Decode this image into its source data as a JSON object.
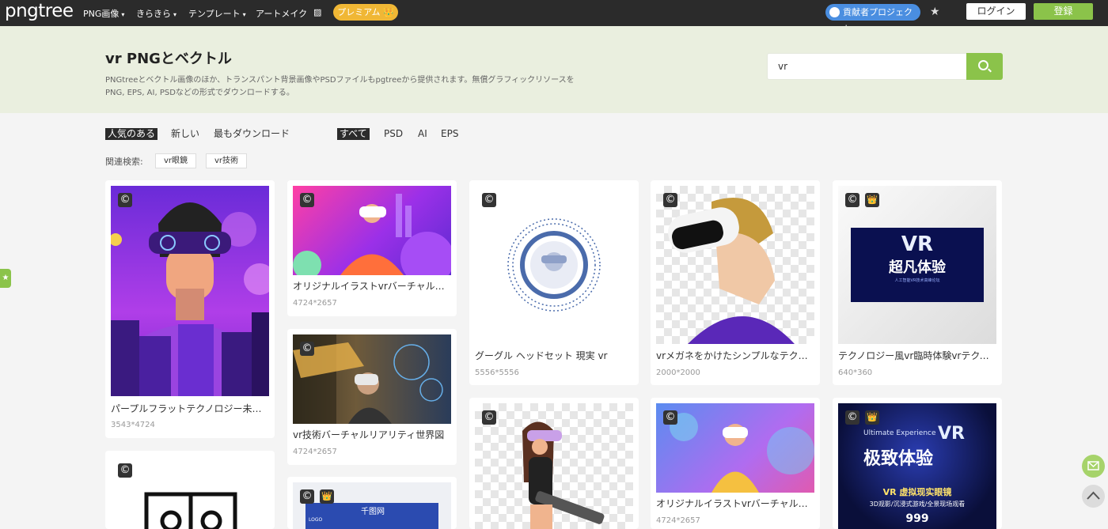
{
  "header": {
    "logo": "pngtree",
    "nav": [
      {
        "label": "PNG画像",
        "caret": "▾"
      },
      {
        "label": "きらきら",
        "caret": "▾"
      },
      {
        "label": "テンプレート",
        "caret": "▾"
      },
      {
        "label": "アートメイク",
        "caret": ""
      },
      {
        "label": "▨",
        "caret": ""
      }
    ],
    "premium": "プレミアム 👑",
    "contributor": "貢献者プロジェクト",
    "star": "★",
    "login": "ログイン",
    "register": "登録"
  },
  "hero": {
    "title": "vr PNGとベクトル",
    "description": "PNGtreeとベクトル画像のほか、トランスパント背景画像やPSDファイルもpgtreeから提供されます。無償グラフィックリソースをPNG, EPS, AI, PSDなどの形式でダウンロードする。",
    "search_value": "vr"
  },
  "filters": {
    "sort": [
      "人気のある",
      "新しい",
      "最もダウンロード"
    ],
    "format": [
      "すべて",
      "PSD",
      "AI",
      "EPS"
    ]
  },
  "related": {
    "label": "関連検索:",
    "tags": [
      "vr眼鏡",
      "vr技術"
    ]
  },
  "side_tab": "★",
  "cards": [
    {
      "title": "パープルフラットテクノロジー未…",
      "size": "3543*4724"
    },
    {
      "title": "オリジナルイラストvrバーチャル…",
      "size": "4724*2657"
    },
    {
      "title": "vr技術バーチャルリアリティ世界図",
      "size": "4724*2657"
    },
    {
      "title": "グーグル ヘッドセット 現実 vr",
      "size": "5556*5556"
    },
    {
      "title": "vrメガネをかけたシンプルなテク…",
      "size": "2000*2000"
    },
    {
      "title": "オリジナルイラストvrバーチャル…",
      "size": "4724*2657"
    },
    {
      "title": "テクノロジー風vr臨時体験vrテクノ…",
      "size": "640*360"
    }
  ],
  "image_text": {
    "vr1_big": "VR",
    "vr1_cn": "超凡体验",
    "vr1_sub": "人工智能VR技术高峰论坛",
    "vr2_top": "Ultimate Experience",
    "vr2_vr": "VR",
    "vr2_cn": "极致体验",
    "vr2_line1": "VR 虚拟现实眼镜",
    "vr2_line2": "3D观影/沉浸式游戏/全景现场观看",
    "vr2_price": "999",
    "banner": "千图网",
    "banner_logo": "LOGO"
  },
  "badges": {
    "copyright": "©",
    "premium": "👑"
  },
  "colors": {
    "accent": "#8bc34a",
    "premium": "#f0b735",
    "contributor": "#4a8ee0",
    "topbar": "#2b2b2b"
  }
}
